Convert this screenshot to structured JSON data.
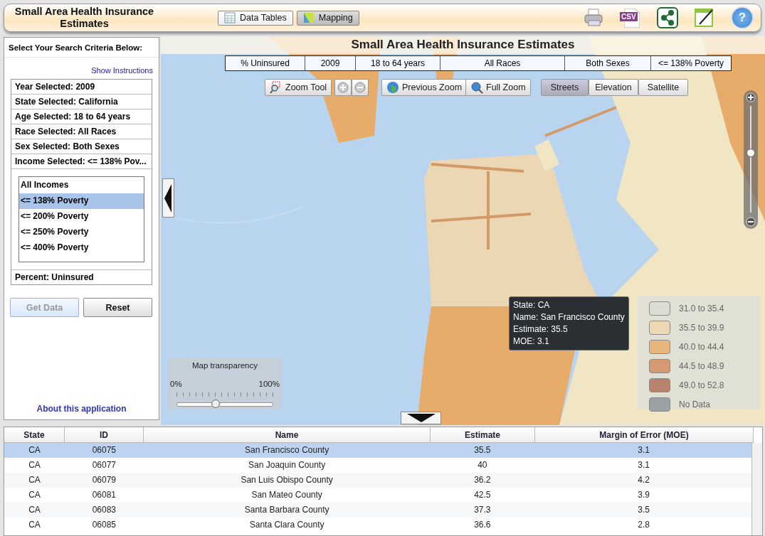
{
  "header": {
    "title": "Small Area Health Insurance Estimates",
    "tabs": [
      {
        "label": "Data Tables",
        "selected": false
      },
      {
        "label": "Mapping",
        "selected": true
      }
    ],
    "tools": [
      {
        "kind": "print"
      },
      {
        "kind": "csv",
        "label": "CSV"
      },
      {
        "kind": "share"
      },
      {
        "kind": "note"
      },
      {
        "kind": "help",
        "label": "?"
      }
    ]
  },
  "sidebar": {
    "heading": "Select Your Search Criteria Below:",
    "instructions_link": "Show Instructions",
    "criteria": [
      "Year Selected: 2009",
      "State Selected: California",
      "Age Selected: 18 to 64 years",
      "Race Selected: All Races",
      "Sex Selected: Both Sexes",
      "Income Selected: <= 138% Pov..."
    ],
    "income_options": [
      {
        "label": "All Incomes",
        "selected": false
      },
      {
        "label": "<= 138% Poverty",
        "selected": true
      },
      {
        "label": "<= 200% Poverty",
        "selected": false
      },
      {
        "label": "<= 250% Poverty",
        "selected": false
      },
      {
        "label": "<= 400% Poverty",
        "selected": false
      }
    ],
    "measure": "Percent: Uninsured",
    "buttons": [
      {
        "label": "Get Data",
        "disabled": true
      },
      {
        "label": "Reset",
        "disabled": false
      }
    ],
    "about_link": "About this application"
  },
  "map": {
    "title": "Small Area Health Insurance Estimates",
    "filters": [
      "% Uninsured",
      "2009",
      "18 to 64 years",
      "All Races",
      "Both Sexes",
      "<= 138% Poverty"
    ],
    "tools": [
      {
        "kind": "zoom-tool",
        "label": "Zoom Tool"
      },
      {
        "kind": "zoom-in"
      },
      {
        "kind": "zoom-out"
      },
      {
        "kind": "previous",
        "label": "Previous Zoom"
      },
      {
        "kind": "full",
        "label": "Full Zoom"
      }
    ],
    "basemaps": [
      {
        "label": "Streets",
        "selected": true
      },
      {
        "label": "Elevation",
        "selected": false
      },
      {
        "label": "Satellite",
        "selected": false
      }
    ],
    "zoom_slider": {
      "level": 0.56
    },
    "tooltip": [
      "State: CA",
      "Name: San Francisco County",
      "Estimate: 35.5",
      "MOE: 3.1"
    ],
    "legend": [
      {
        "label": "31.0 to 35.4",
        "color": "#dcdcd2"
      },
      {
        "label": "35.5 to 39.9",
        "color": "#ecd9b4"
      },
      {
        "label": "40.0 to 44.4",
        "color": "#e8b57c"
      },
      {
        "label": "44.5 to 48.9",
        "color": "#d59a72"
      },
      {
        "label": "49.0 to 52.8",
        "color": "#b7836d"
      },
      {
        "label": "No Data",
        "color": "#9aa2a6"
      }
    ],
    "transparency": {
      "label": "Map transparency",
      "min_label": "0%",
      "max_label": "100%",
      "level": 0.4
    }
  },
  "table": {
    "columns": [
      "State",
      "ID",
      "Name",
      "Estimate",
      "Margin of Error (MOE)"
    ],
    "rows": [
      {
        "cells": [
          "CA",
          "06075",
          "San Francisco County",
          "35.5",
          "3.1"
        ],
        "selected": true
      },
      {
        "cells": [
          "CA",
          "06077",
          "San Joaquin County",
          "40",
          "3.1"
        ],
        "selected": false
      },
      {
        "cells": [
          "CA",
          "06079",
          "San Luis Obispo County",
          "36.2",
          "4.2"
        ],
        "selected": false
      },
      {
        "cells": [
          "CA",
          "06081",
          "San Mateo County",
          "42.5",
          "3.9"
        ],
        "selected": false
      },
      {
        "cells": [
          "CA",
          "06083",
          "Santa Barbara County",
          "37.3",
          "3.5"
        ],
        "selected": false
      },
      {
        "cells": [
          "CA",
          "06085",
          "Santa Clara County",
          "36.6",
          "2.8"
        ],
        "selected": false
      }
    ]
  }
}
